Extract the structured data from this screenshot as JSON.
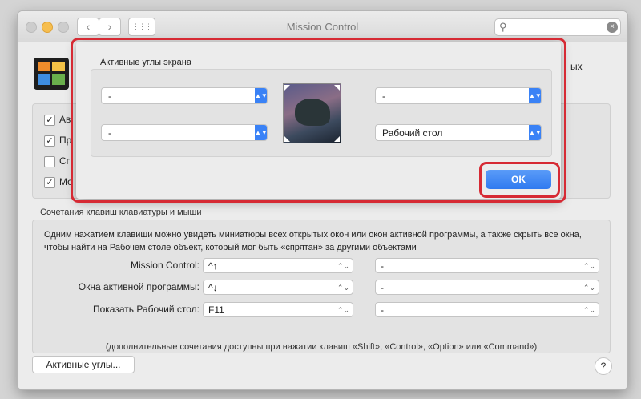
{
  "window": {
    "title": "Mission Control",
    "nav_back": "‹",
    "nav_forward": "›",
    "grid": "⋮⋮⋮",
    "search_icon": "⚲",
    "search_clear": "×"
  },
  "pane": {
    "desc_fragment": "ых",
    "options": [
      {
        "label": "Ав",
        "checked": true
      },
      {
        "label": "Пр",
        "checked": true
      },
      {
        "label": "Сг",
        "checked": false
      },
      {
        "label": "Мо",
        "checked": true
      }
    ]
  },
  "keys": {
    "section_label": "Сочетания клавиш клавиатуры и мыши",
    "description": "Одним нажатием клавиши можно увидеть миниатюры всех открытых окон или окон активной программы, а также скрыть все окна, чтобы найти на Рабочем столе объект, который мог быть «спрятан» за другими объектами",
    "rows": [
      {
        "label": "Mission Control:",
        "key": "^↑",
        "mouse": "-"
      },
      {
        "label": "Окна активной программы:",
        "key": "^↓",
        "mouse": "-"
      },
      {
        "label": "Показать Рабочий стол:",
        "key": "F11",
        "mouse": "-"
      }
    ],
    "footnote": "(дополнительные сочетания доступны при нажатии клавиш «Shift», «Control», «Option» или «Command»)"
  },
  "bottom": {
    "hot_corners_button": "Активные углы...",
    "help": "?"
  },
  "sheet": {
    "title": "Активные углы экрана",
    "top_left": "-",
    "top_right": "-",
    "bottom_left": "-",
    "bottom_right": "Рабочий стол",
    "ok": "OK"
  },
  "colors": {
    "accent": "#3a82f6",
    "highlight": "#d62a34"
  }
}
